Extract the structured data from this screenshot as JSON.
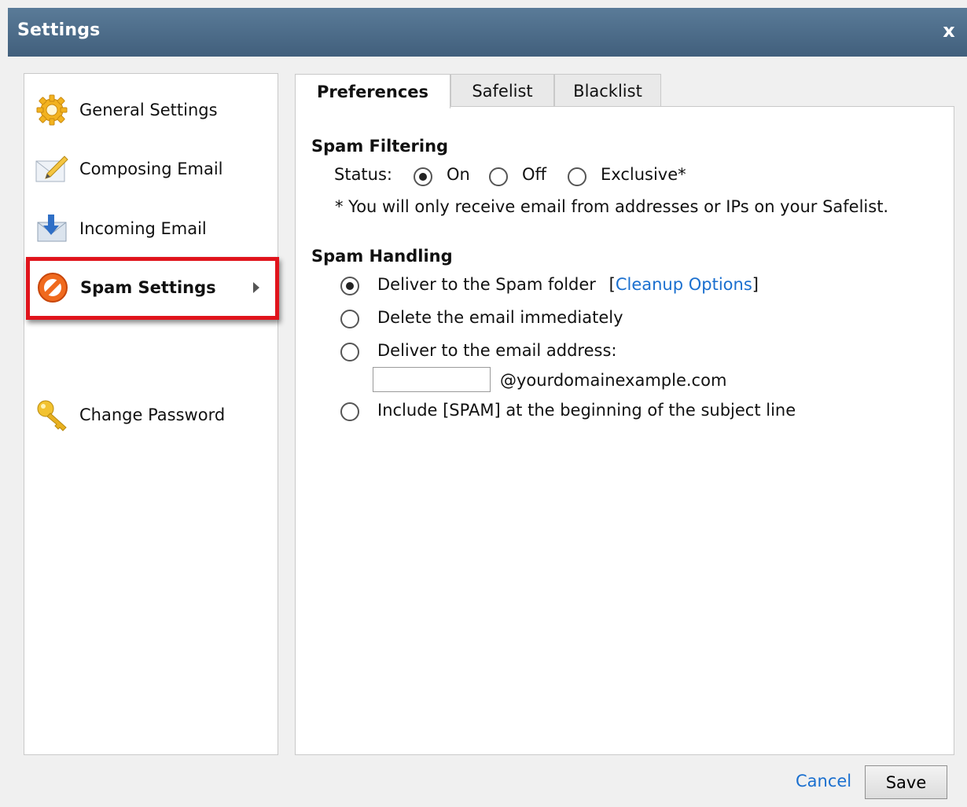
{
  "window": {
    "title": "Settings",
    "close_label": "x"
  },
  "sidebar": {
    "items": [
      {
        "label": "General Settings",
        "icon": "gear-icon"
      },
      {
        "label": "Composing Email",
        "icon": "pencil-envelope-icon"
      },
      {
        "label": "Incoming Email",
        "icon": "download-envelope-icon"
      },
      {
        "label": "Spam Settings",
        "icon": "no-entry-icon",
        "selected": true
      },
      {
        "label": "Change Password",
        "icon": "key-icon"
      }
    ],
    "highlight_color": "#e0141c"
  },
  "tabs": [
    {
      "label": "Preferences",
      "active": true
    },
    {
      "label": "Safelist",
      "active": false
    },
    {
      "label": "Blacklist",
      "active": false
    }
  ],
  "spam_filtering": {
    "heading": "Spam Filtering",
    "status_label": "Status:",
    "options": [
      {
        "label": "On",
        "checked": true
      },
      {
        "label": "Off",
        "checked": false
      },
      {
        "label": "Exclusive*",
        "checked": false
      }
    ],
    "note": "* You will only receive email from addresses or IPs on your Safelist."
  },
  "spam_handling": {
    "heading": "Spam Handling",
    "options": [
      {
        "label": "Deliver to the Spam folder",
        "checked": true
      },
      {
        "label": "Delete the email immediately",
        "checked": false
      },
      {
        "label": "Deliver to the email address:",
        "checked": false
      },
      {
        "label": "Include [SPAM] at the beginning of the subject line",
        "checked": false
      }
    ],
    "cleanup_open": "[",
    "cleanup_link": "Cleanup Options",
    "cleanup_close": "]",
    "email_value": "",
    "domain_suffix": "@yourdomainexample.com"
  },
  "footer": {
    "cancel_label": "Cancel",
    "save_label": "Save"
  },
  "colors": {
    "title_bar": "#4b6a88",
    "link": "#1a6fcf"
  }
}
